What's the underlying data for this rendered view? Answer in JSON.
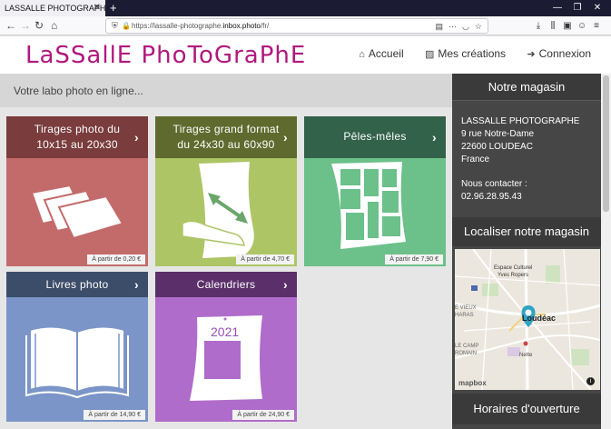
{
  "browser": {
    "tab_title": "LASSALLE PHOTOGRAPHE",
    "url_prefix": "https://lassalle-photographe.",
    "url_domain": "inbox.photo",
    "url_suffix": "/fr/"
  },
  "header": {
    "logo": "LaSSallE PhoToGraPhE",
    "menu": [
      {
        "label": "Accueil",
        "icon": "home-icon"
      },
      {
        "label": "Mes créations",
        "icon": "image-icon"
      },
      {
        "label": "Connexion",
        "icon": "sign-in-icon"
      }
    ]
  },
  "slogan": "Votre labo photo en ligne...",
  "products": [
    {
      "title_line1": "Tirages photo du",
      "title_line2": "10x15 au 20x30",
      "price": "À partir de 0,20 €",
      "header_color": "#7a3c3c",
      "body_color": "#c36b6b"
    },
    {
      "title_line1": "Tirages grand format",
      "title_line2": "du 24x30 au 60x90",
      "price": "À partir de 4,70 €",
      "header_color": "#5f6a2e",
      "body_color": "#aec566"
    },
    {
      "title_line1": "Pêles-mêles",
      "title_line2": "",
      "price": "À partir de 7,90 €",
      "header_color": "#33624a",
      "body_color": "#6cc08a"
    },
    {
      "title_line1": "Livres photo",
      "title_line2": "",
      "price": "À partir de 14,90 €",
      "header_color": "#3c4d69",
      "body_color": "#7b95c8"
    },
    {
      "title_line1": "Calendriers",
      "title_line2": "",
      "price": "À partir de 24,90 €",
      "header_color": "#5a2f6a",
      "body_color": "#b06cca",
      "year": "2021"
    }
  ],
  "sidebar": {
    "store_heading": "Notre magasin",
    "store_name": "LASSALLE PHOTOGRAPHE",
    "street": "9 rue Notre-Dame",
    "city": "22600 LOUDEAC",
    "country": "France",
    "contact_label": "Nous contacter :",
    "phone": "02.96.28.95.43",
    "map_heading": "Localiser notre magasin",
    "hours_heading": "Horaires d'ouverture",
    "map_labels": {
      "culture1": "Espace Culturel",
      "culture2": "Yves Ropers",
      "vieux": "E VIEUX",
      "haras": "HARAS",
      "camp": "LE CAMP",
      "romain": "ROMAIN",
      "town": "Loudéac",
      "nette": "Nette",
      "mapbox": "mapbox",
      "info": "i"
    }
  }
}
